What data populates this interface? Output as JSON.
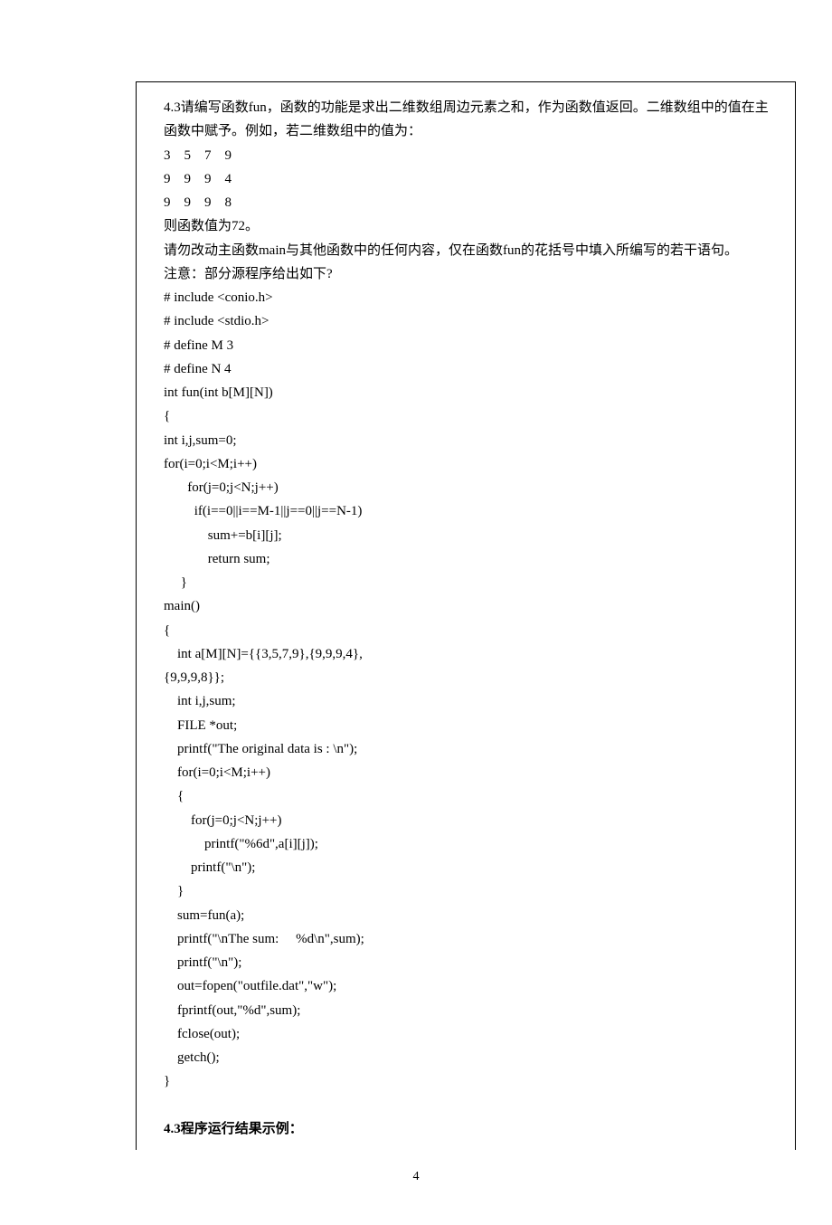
{
  "problem": {
    "description": "4.3请编写函数fun，函数的功能是求出二维数组周边元素之和，作为函数值返回。二维数组中的值在主函数中赋予。例如，若二维数组中的值为：",
    "matrix_rows": [
      "3    5    7    9",
      "9    9    9    4",
      "9    9    9    8"
    ],
    "result_note": "则函数值为72。",
    "instruction": "请勿改动主函数main与其他函数中的任何内容，仅在函数fun的花括号中填入所编写的若干语句。",
    "note_label": "注意：部分源程序给出如下?"
  },
  "code_lines": [
    "# include <conio.h>",
    "# include <stdio.h>",
    "# define M 3",
    "# define N 4",
    "int fun(int b[M][N])",
    "{",
    "int i,j,sum=0;",
    "for(i=0;i<M;i++)",
    "       for(j=0;j<N;j++)",
    "         if(i==0||i==M-1||j==0||j==N-1)",
    "             sum+=b[i][j];",
    "             return sum;",
    "     }",
    "main()",
    "{",
    "    int a[M][N]={{3,5,7,9},{9,9,9,4},",
    "{9,9,9,8}};",
    "    int i,j,sum;",
    "    FILE *out;",
    "    printf(\"The original data is : \\n\");",
    "    for(i=0;i<M;i++)",
    "    {",
    "        for(j=0;j<N;j++)",
    "            printf(\"%6d\",a[i][j]);",
    "        printf(\"\\n\");",
    "    }",
    "    sum=fun(a);",
    "    printf(\"\\nThe sum:     %d\\n\",sum);",
    "    printf(\"\\n\");",
    "    out=fopen(\"outfile.dat\",\"w\");",
    "    fprintf(out,\"%d\",sum);",
    "    fclose(out);",
    "    getch();",
    "}"
  ],
  "footer_heading": "4.3程序运行结果示例：",
  "page_number": "4"
}
